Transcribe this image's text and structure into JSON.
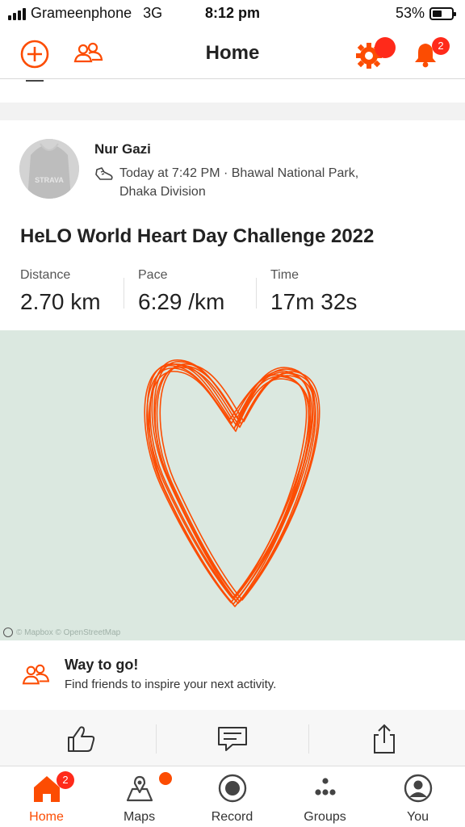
{
  "status_bar": {
    "carrier": "Grameenphone",
    "network": "3G",
    "time": "8:12 pm",
    "battery": "53%"
  },
  "header": {
    "title": "Home",
    "icons": [
      "add-circle-icon",
      "find-friends-icon",
      "settings-gear-icon",
      "notification-bell-icon"
    ],
    "notification_count": "2"
  },
  "activity": {
    "athlete_name": "Nur Gazi",
    "avatar_text": "STRAVA",
    "meta_line1": "Today at 7:42 PM · Bhawal National Park,",
    "meta_line2": "Dhaka Division",
    "title": "HeLO World Heart Day Challenge 2022",
    "stats": [
      {
        "label": "Distance",
        "value": "2.70 km"
      },
      {
        "label": "Pace",
        "value": "6:29 /km"
      },
      {
        "label": "Time",
        "value": "17m 32s"
      }
    ],
    "map_attribution": "© Mapbox © OpenStreetMap",
    "route_color": "#fc4c02"
  },
  "way_to_go": {
    "title": "Way to go!",
    "subtitle": "Find friends to inspire your next activity."
  },
  "actions": [
    "kudos-thumbs-up-icon",
    "comment-icon",
    "share-icon"
  ],
  "tabbar": {
    "tabs": [
      {
        "label": "Home",
        "badge": "2"
      },
      {
        "label": "Maps"
      },
      {
        "label": "Record"
      },
      {
        "label": "Groups"
      },
      {
        "label": "You"
      }
    ]
  },
  "colors": {
    "accent": "#fc4c02",
    "badge": "#ff2a1a",
    "map_bg": "#dbe8e0"
  }
}
